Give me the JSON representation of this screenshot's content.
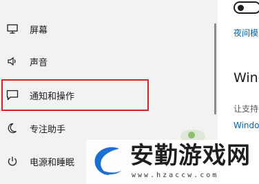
{
  "sidebar": {
    "items": [
      {
        "label": "屏幕",
        "icon": "monitor-icon"
      },
      {
        "label": "声音",
        "icon": "speaker-icon"
      },
      {
        "label": "通知和操作",
        "icon": "notification-icon",
        "highlighted": true
      },
      {
        "label": "专注助手",
        "icon": "moon-icon"
      },
      {
        "label": "电源和睡眠",
        "icon": "power-icon"
      }
    ]
  },
  "content": {
    "night_light_link": "夜间模",
    "heading": "Wind",
    "support_text": "让支持",
    "windows_link": "Windo"
  },
  "watermark": {
    "title": "安勤游戏网",
    "url": "www.hzaccw.com"
  },
  "colors": {
    "highlight_border": "#d9201f",
    "link": "#0063b1",
    "sidebar_bg": "#f2f2f2",
    "logo_blue": "#1a6fd1"
  }
}
